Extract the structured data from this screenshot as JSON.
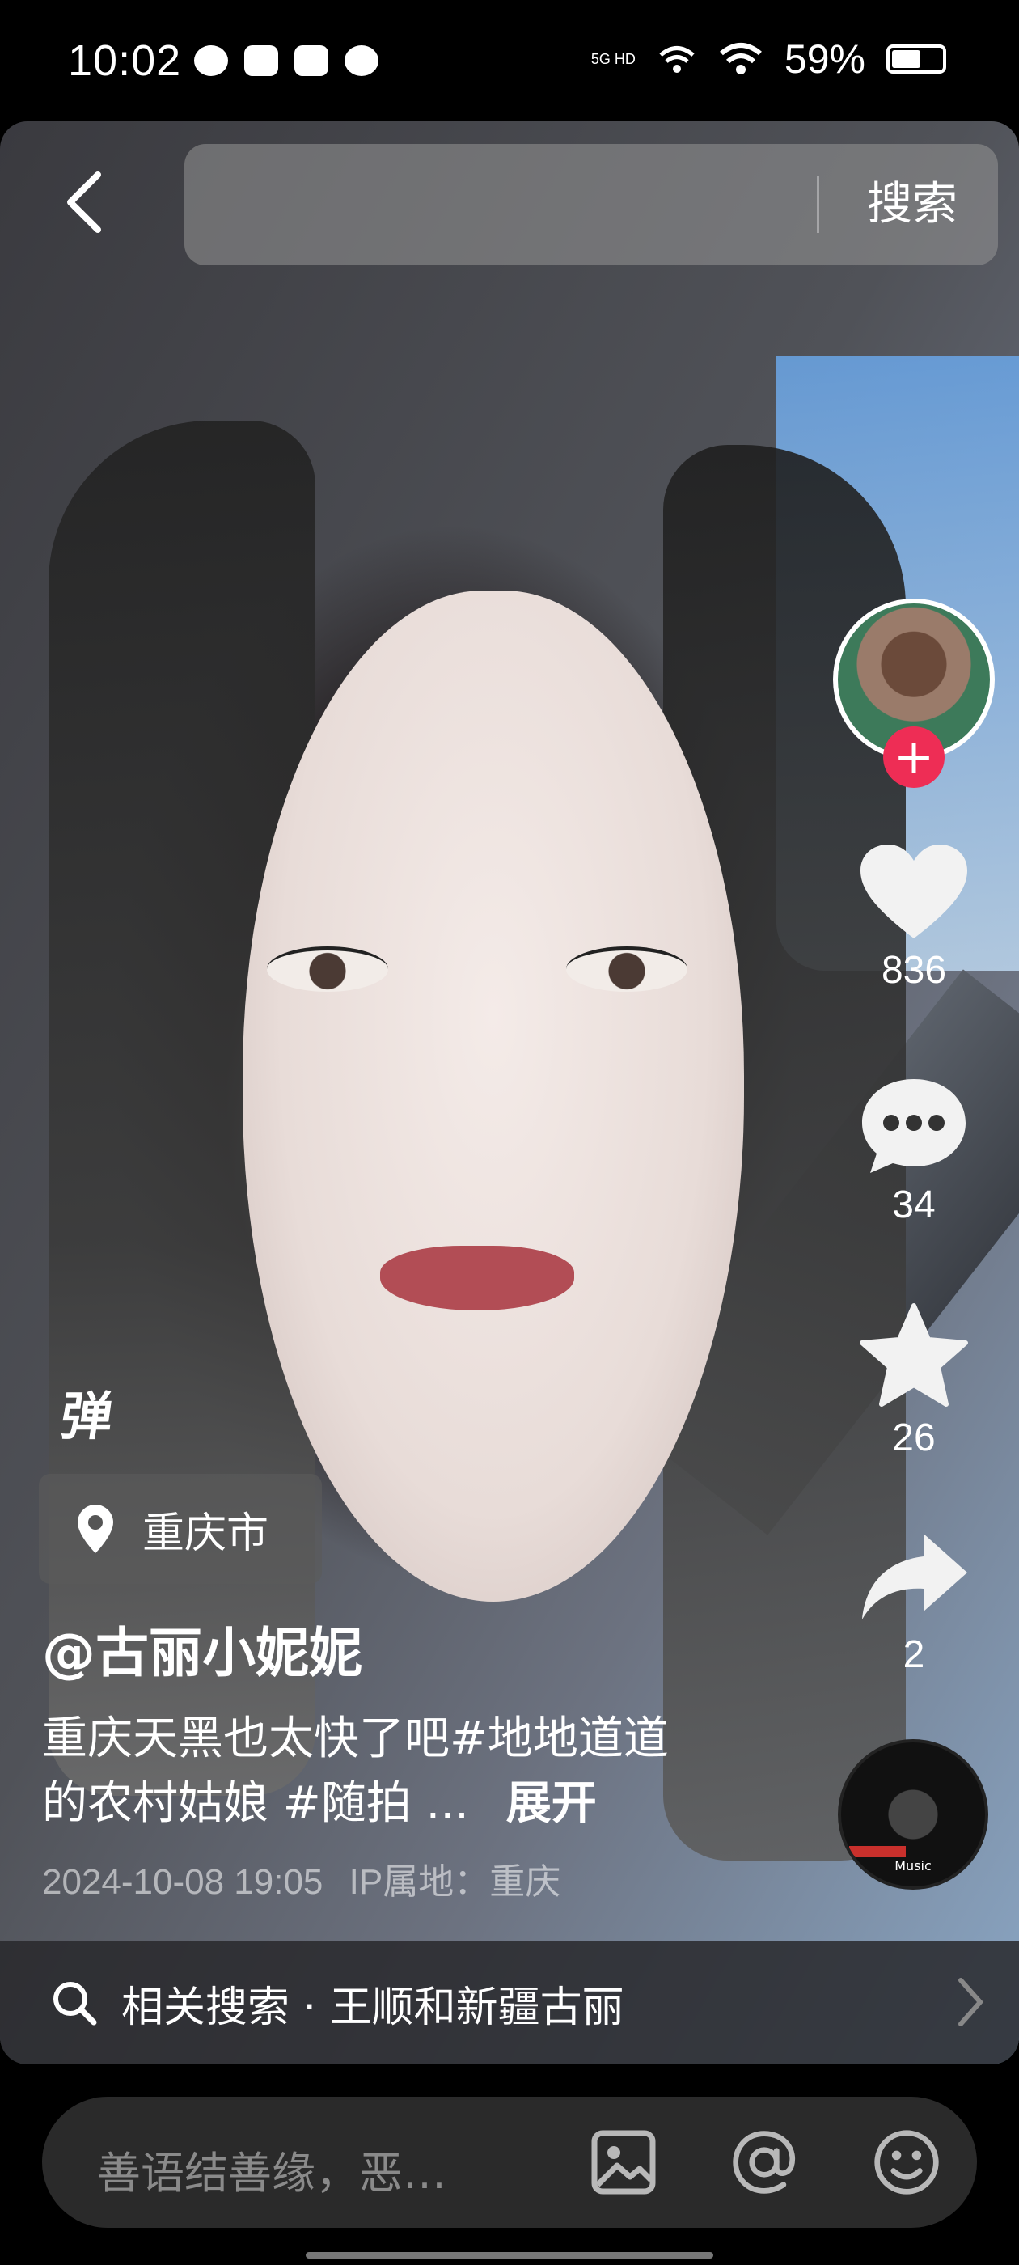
{
  "status_bar": {
    "time": "10:02",
    "network_label": "5G HD",
    "battery_percent": "59%",
    "battery_level": 0.59,
    "notification_icons": [
      "wechat-icon",
      "message-icon",
      "hand-icon",
      "chat-bubble-icon"
    ]
  },
  "search": {
    "placeholder": "",
    "button_label": "搜索"
  },
  "video": {
    "danmu_label": "弹",
    "location": "重庆市",
    "author": "@古丽小妮妮",
    "description": "重庆天黑也太快了吧#地地道道的农村姑娘 #随拍 ...",
    "expand_label": "展开",
    "datetime": "2024-10-08 19:05",
    "ip_location": "IP属地：重庆"
  },
  "actions": {
    "likes": "836",
    "comments": "34",
    "favorites": "26",
    "shares": "2",
    "follow_symbol": "+",
    "music_label": "Music"
  },
  "related_search": {
    "label": "相关搜索 · 王顺和新疆古丽"
  },
  "comment_bar": {
    "placeholder": "善语结善缘，恶…"
  },
  "colors": {
    "accent": "#ee2d55",
    "background": "#000000"
  }
}
